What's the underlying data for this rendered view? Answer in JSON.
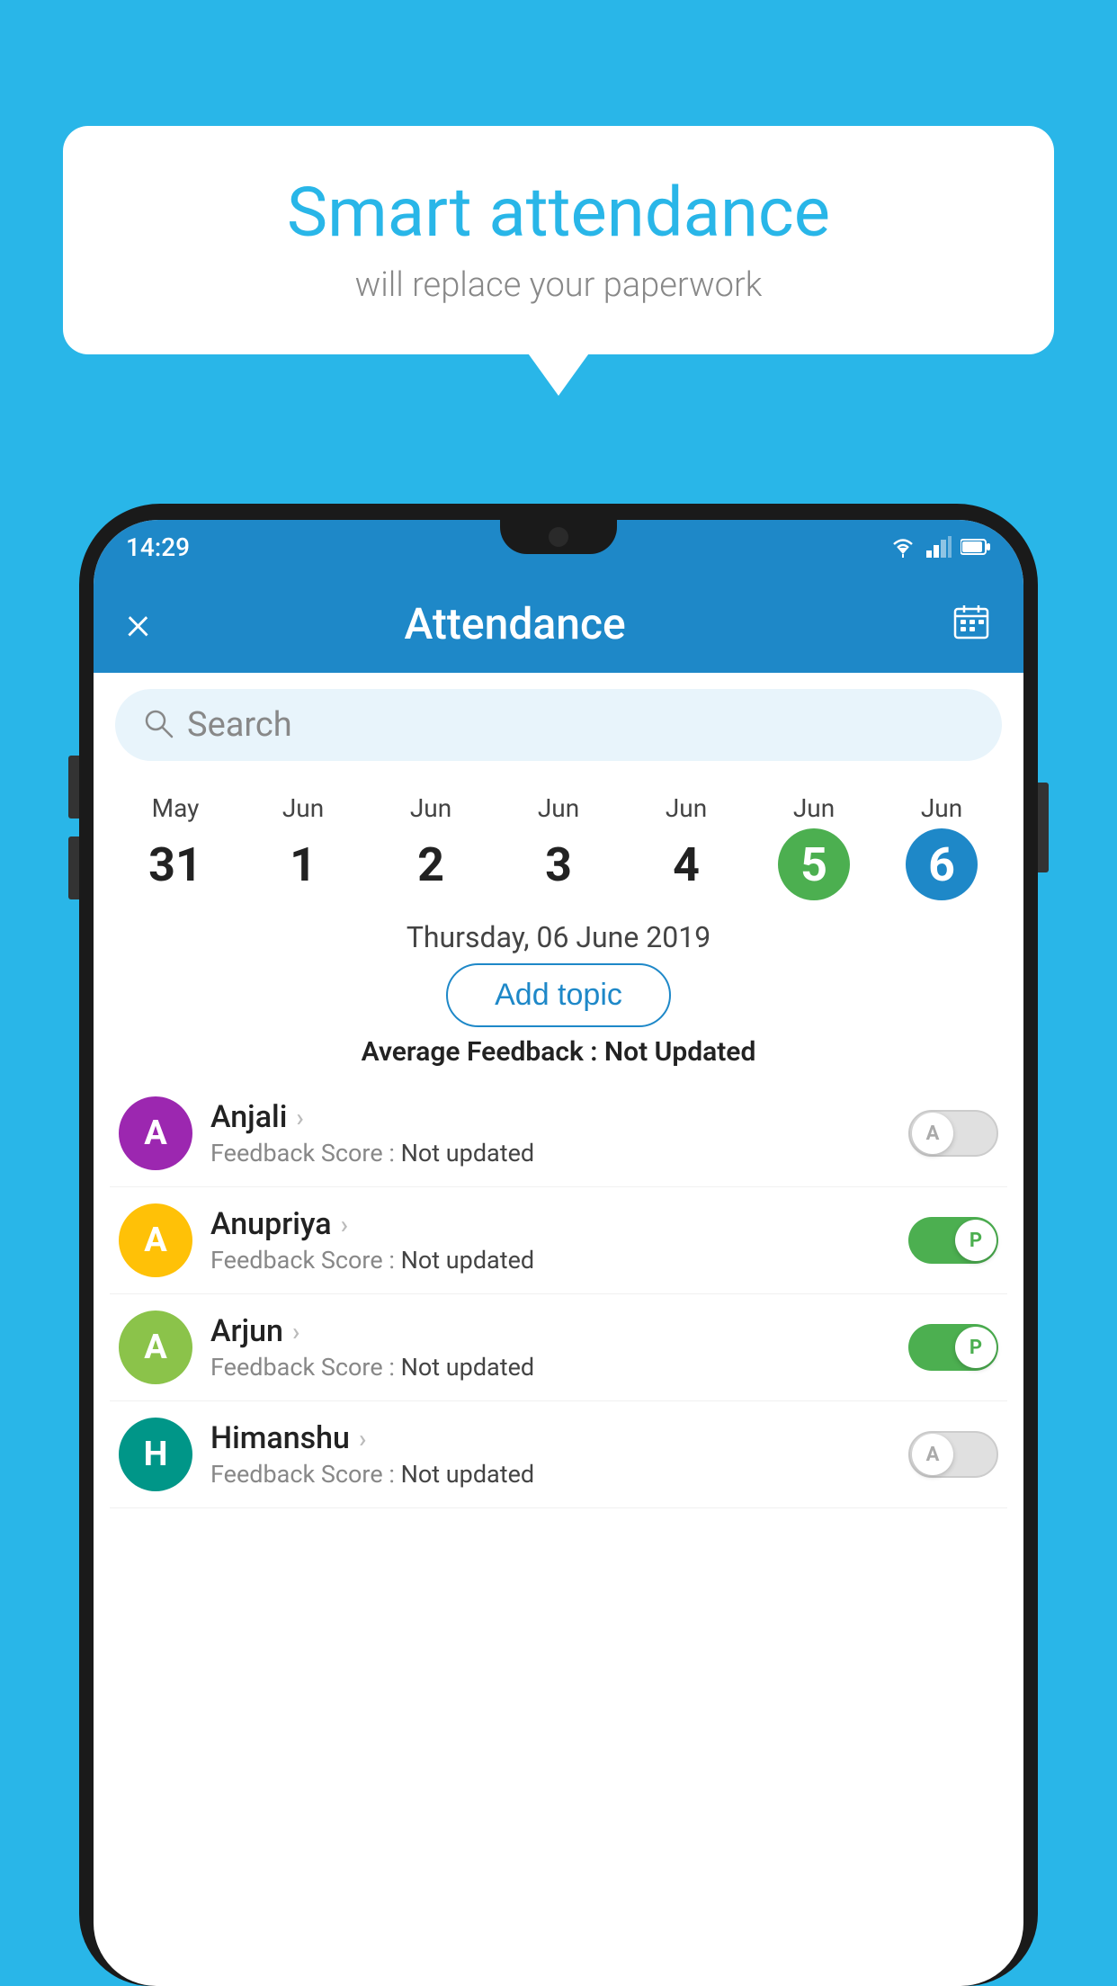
{
  "background_color": "#29b6e8",
  "bubble": {
    "title": "Smart attendance",
    "subtitle": "will replace your paperwork"
  },
  "status_bar": {
    "time": "14:29",
    "icons": [
      "wifi",
      "signal",
      "battery"
    ]
  },
  "app_bar": {
    "close_label": "×",
    "title": "Attendance",
    "calendar_icon": "calendar"
  },
  "search": {
    "placeholder": "Search"
  },
  "dates": [
    {
      "month": "May",
      "day": "31",
      "style": "normal"
    },
    {
      "month": "Jun",
      "day": "1",
      "style": "normal"
    },
    {
      "month": "Jun",
      "day": "2",
      "style": "normal"
    },
    {
      "month": "Jun",
      "day": "3",
      "style": "normal"
    },
    {
      "month": "Jun",
      "day": "4",
      "style": "normal"
    },
    {
      "month": "Jun",
      "day": "5",
      "style": "green"
    },
    {
      "month": "Jun",
      "day": "6",
      "style": "blue"
    }
  ],
  "selected_date_label": "Thursday, 06 June 2019",
  "add_topic_label": "Add topic",
  "avg_feedback_label": "Average Feedback :",
  "avg_feedback_value": "Not Updated",
  "students": [
    {
      "name": "Anjali",
      "avatar_letter": "A",
      "avatar_color": "purple",
      "feedback_label": "Feedback Score :",
      "feedback_value": "Not updated",
      "toggle_state": "off",
      "toggle_letter": "A"
    },
    {
      "name": "Anupriya",
      "avatar_letter": "A",
      "avatar_color": "amber",
      "feedback_label": "Feedback Score :",
      "feedback_value": "Not updated",
      "toggle_state": "on",
      "toggle_letter": "P"
    },
    {
      "name": "Arjun",
      "avatar_letter": "A",
      "avatar_color": "green-light",
      "feedback_label": "Feedback Score :",
      "feedback_value": "Not updated",
      "toggle_state": "on",
      "toggle_letter": "P"
    },
    {
      "name": "Himanshu",
      "avatar_letter": "H",
      "avatar_color": "teal",
      "feedback_label": "Feedback Score :",
      "feedback_value": "Not updated",
      "toggle_state": "off",
      "toggle_letter": "A"
    }
  ]
}
